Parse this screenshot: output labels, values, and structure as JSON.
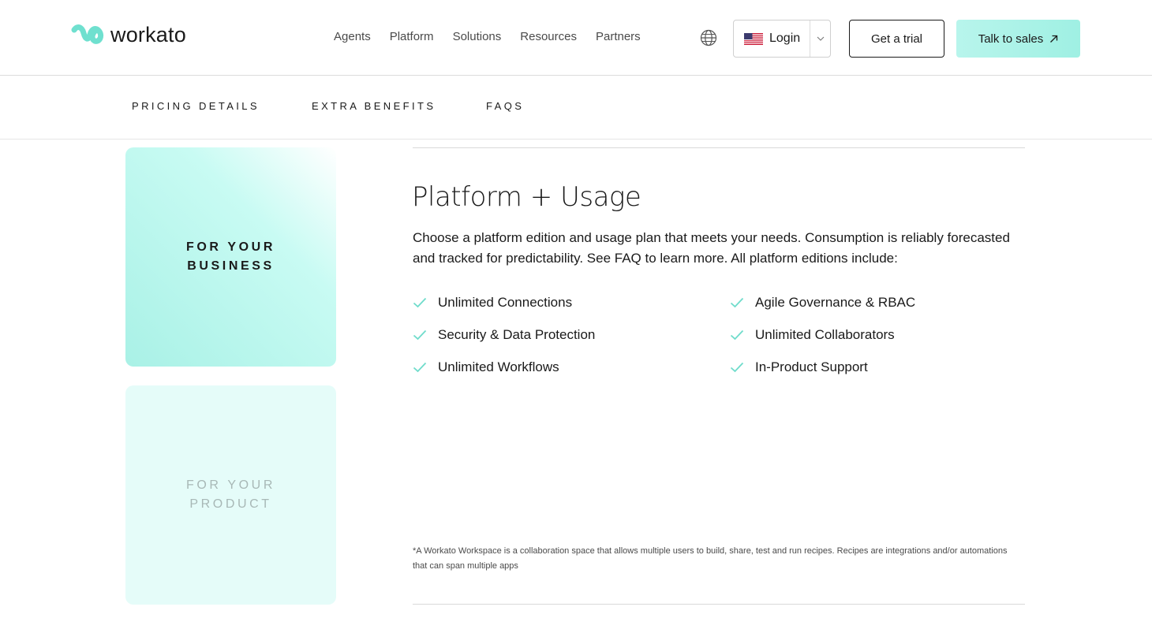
{
  "header": {
    "logo_text": "workato",
    "nav": [
      "Agents",
      "Platform",
      "Solutions",
      "Resources",
      "Partners"
    ],
    "login_label": "Login",
    "trial_label": "Get a trial",
    "sales_label": "Talk to sales"
  },
  "subnav": {
    "items": [
      "PRICING DETAILS",
      "EXTRA BENEFITS",
      "FAQS"
    ]
  },
  "tiles": {
    "business_label": "FOR YOUR BUSINESS",
    "product_label": "FOR YOUR PRODUCT"
  },
  "content": {
    "title": "Platform + Usage",
    "description": "Choose a platform edition and usage plan that meets your needs. Consumption is reliably forecasted and tracked for predictability. See FAQ to learn more. All platform editions include:",
    "features_left": [
      "Unlimited Connections",
      "Security & Data Protection",
      "Unlimited Workflows"
    ],
    "features_right": [
      "Agile Governance & RBAC",
      "Unlimited Collaborators",
      "In-Product Support"
    ],
    "footnote": "*A Workato Workspace is a collaboration space that allows multiple users to build, share, test and run recipes. Recipes are integrations and/or automations that can span multiple apps"
  },
  "colors": {
    "accent": "#9ff0e3",
    "check": "#6fdccb"
  },
  "icons": [
    "workato-logo-icon",
    "globe-icon",
    "us-flag-icon",
    "chevron-down-icon",
    "arrow-up-right-icon",
    "check-icon"
  ]
}
